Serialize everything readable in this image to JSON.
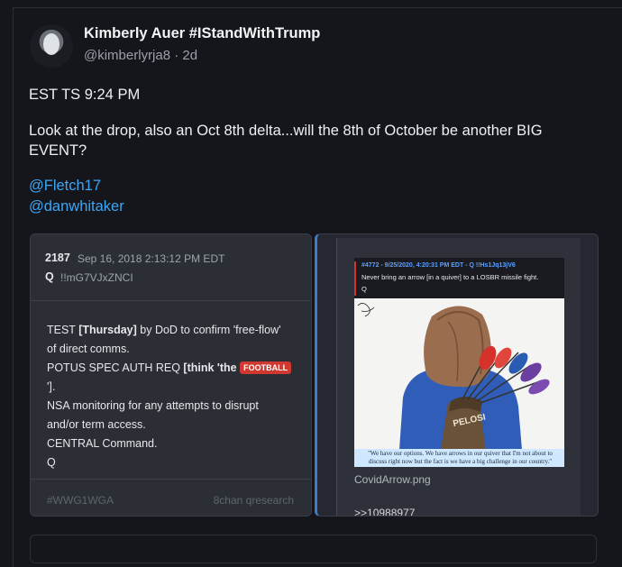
{
  "author": {
    "name": "Kimberly Auer #IStandWithTrump",
    "handle": "@kimberlyrja8",
    "time": "· 2d"
  },
  "post": {
    "line1": "EST TS 9:24 PM",
    "line2a": "Look at the drop, also an Oct 8th delta...will the 8th of October be another BIG",
    "line2b": "EVENT?",
    "mention1": "@Fletch17",
    "mention2": "@danwhitaker"
  },
  "qdrop": {
    "number": "2187",
    "date": "Sep 16, 2018 2:13:12 PM EDT",
    "q": "Q",
    "tripcode": "!!mG7VJxZNCI",
    "body": {
      "l1a": "TEST ",
      "l1b": "[Thursday]",
      "l1c": " by DoD to confirm 'free-flow'",
      "l2": "of direct comms.",
      "l3a": "POTUS SPEC AUTH REQ ",
      "l3b": "[think 'the ",
      "badge": "FOOTBALL",
      "l4": "'].",
      "l5": "NSA monitoring for any attempts to disrupt",
      "l6": "and/or term access.",
      "l7": "CENTRAL Command.",
      "l8": "Q"
    },
    "hashtag": "#WWG1WGA",
    "source": "8chan qresearch"
  },
  "image_card": {
    "post_header": "#4772 - 9/25/2020, 4:20:31 PM EDT - Q !!Hs1Jq13jV6",
    "post_line": "Never bring an arrow [in a quiver] to a LOSBR missile fight.",
    "post_sig": "Q",
    "quiver_label": "PELOSI",
    "caption": "\"We have our options. We have arrows in our quiver that I'm not about to discuss right now but the fact is we have a big challenge in our country.\"",
    "filename": "CovidArrow.png",
    "reply_ref": ">>10988977"
  },
  "colors": {
    "background": "#15161c",
    "link": "#3ea6f4",
    "badge": "#d0392f",
    "card_accent": "#3b7ec4"
  }
}
